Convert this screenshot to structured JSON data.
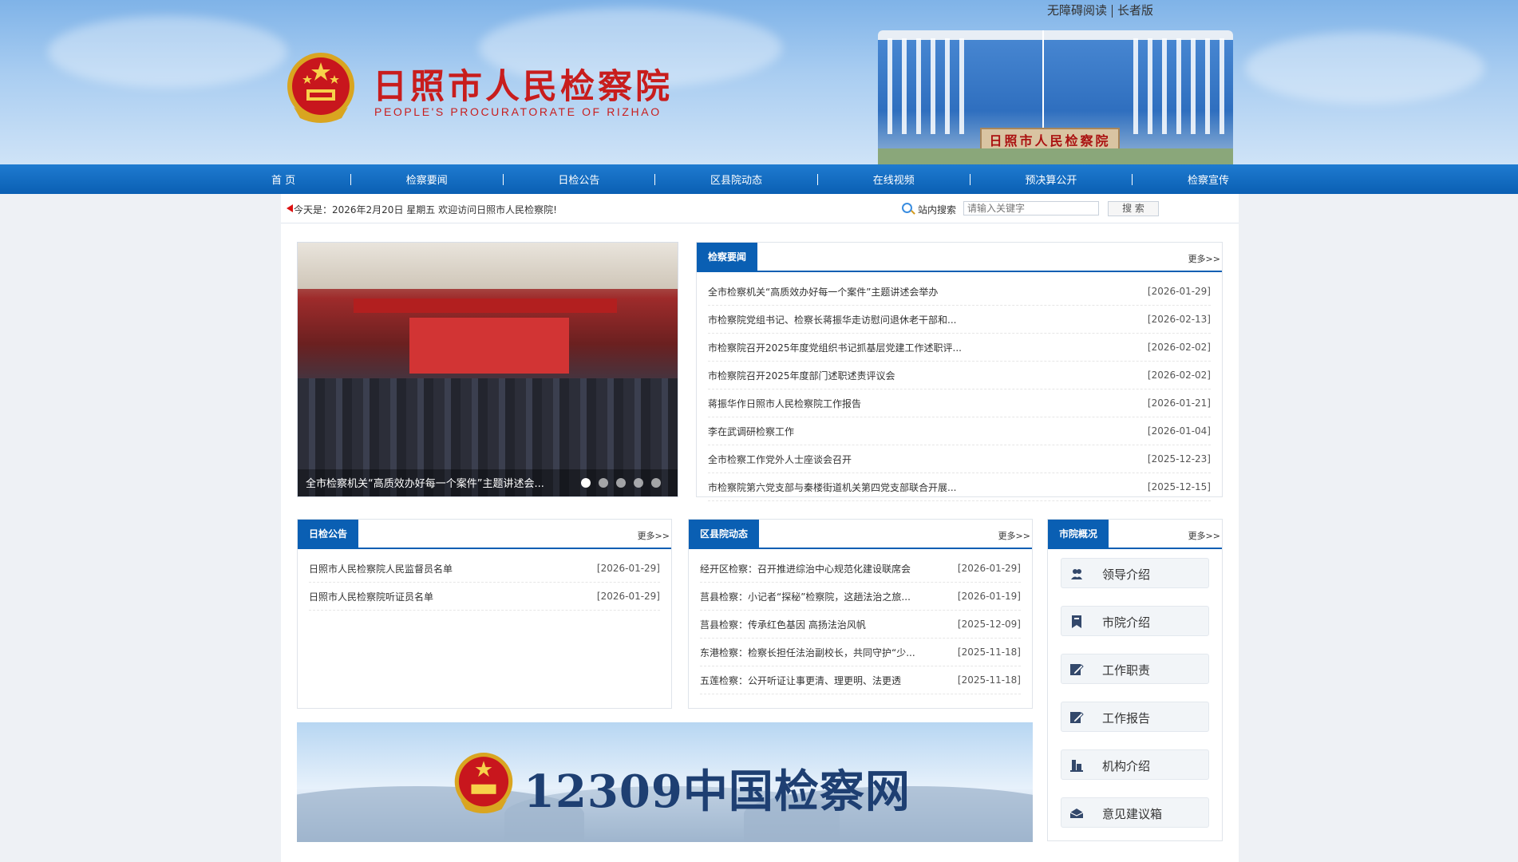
{
  "header": {
    "title": "日照市人民检察院",
    "subtitle": "PEOPLE'S PROCURATORATE OF RIZHAO",
    "building_sign": "日照市人民检察院",
    "accessibility_label": "无障碍阅读",
    "elder_label": "长者版"
  },
  "nav": {
    "items": [
      "首 页",
      "检察要闻",
      "日检公告",
      "区县院动态",
      "在线视频",
      "预决算公开",
      "检察宣传"
    ]
  },
  "infobar": {
    "date_text": "今天是：2026年2月20日 星期五 欢迎访问日照市人民检察院!",
    "search_label": "站内搜索",
    "search_placeholder": "请输入关键字",
    "search_button": "搜 索"
  },
  "slider": {
    "caption": "全市检察机关“高质效办好每一个案件”主题讲述会...",
    "slide_count": 5,
    "active_index": 0
  },
  "news": {
    "title": "检察要闻",
    "more": "更多>>",
    "items": [
      {
        "title": "全市检察机关“高质效办好每一个案件”主题讲述会举办",
        "date": "[2026-01-29]"
      },
      {
        "title": "市检察院党组书记、检察长蒋振华走访慰问退休老干部和...",
        "date": "[2026-02-13]"
      },
      {
        "title": "市检察院召开2025年度党组织书记抓基层党建工作述职评...",
        "date": "[2026-02-02]"
      },
      {
        "title": "市检察院召开2025年度部门述职述责评议会",
        "date": "[2026-02-02]"
      },
      {
        "title": "蒋振华作日照市人民检察院工作报告",
        "date": "[2026-01-21]"
      },
      {
        "title": "李在武调研检察工作",
        "date": "[2026-01-04]"
      },
      {
        "title": "全市检察工作党外人士座谈会召开",
        "date": "[2025-12-23]"
      },
      {
        "title": "市检察院第六党支部与秦楼街道机关第四党支部联合开展...",
        "date": "[2025-12-15]"
      }
    ]
  },
  "notice": {
    "title": "日检公告",
    "more": "更多>>",
    "items": [
      {
        "title": "日照市人民检察院人民监督员名单",
        "date": "[2026-01-29]"
      },
      {
        "title": "日照市人民检察院听证员名单",
        "date": "[2026-01-29]"
      }
    ]
  },
  "district": {
    "title": "区县院动态",
    "more": "更多>>",
    "items": [
      {
        "title": "经开区检察：召开推进综治中心规范化建设联席会",
        "date": "[2026-01-29]"
      },
      {
        "title": "莒县检察：小记者“探秘”检察院，这趟法治之旅...",
        "date": "[2026-01-19]"
      },
      {
        "title": "莒县检察：传承红色基因 高扬法治风帆",
        "date": "[2025-12-09]"
      },
      {
        "title": "东港检察：检察长担任法治副校长，共同守护“少...",
        "date": "[2025-11-18]"
      },
      {
        "title": "五莲检察：公开听证让事更清、理更明、法更透",
        "date": "[2025-11-18]"
      }
    ]
  },
  "overview": {
    "title": "市院概况",
    "more": "更多>>",
    "items": [
      {
        "label": "领导介绍",
        "icon": "leaders-icon"
      },
      {
        "label": "市院介绍",
        "icon": "bookmark-icon"
      },
      {
        "label": "工作职责",
        "icon": "edit-icon"
      },
      {
        "label": "工作报告",
        "icon": "report-icon"
      },
      {
        "label": "机构介绍",
        "icon": "organization-icon"
      },
      {
        "label": "意见建议箱",
        "icon": "mailbox-icon"
      }
    ]
  },
  "banner": {
    "text": "12309中国检察网"
  },
  "colors": {
    "brand_blue": "#0a5fb3",
    "title_red": "#c81d1d"
  }
}
